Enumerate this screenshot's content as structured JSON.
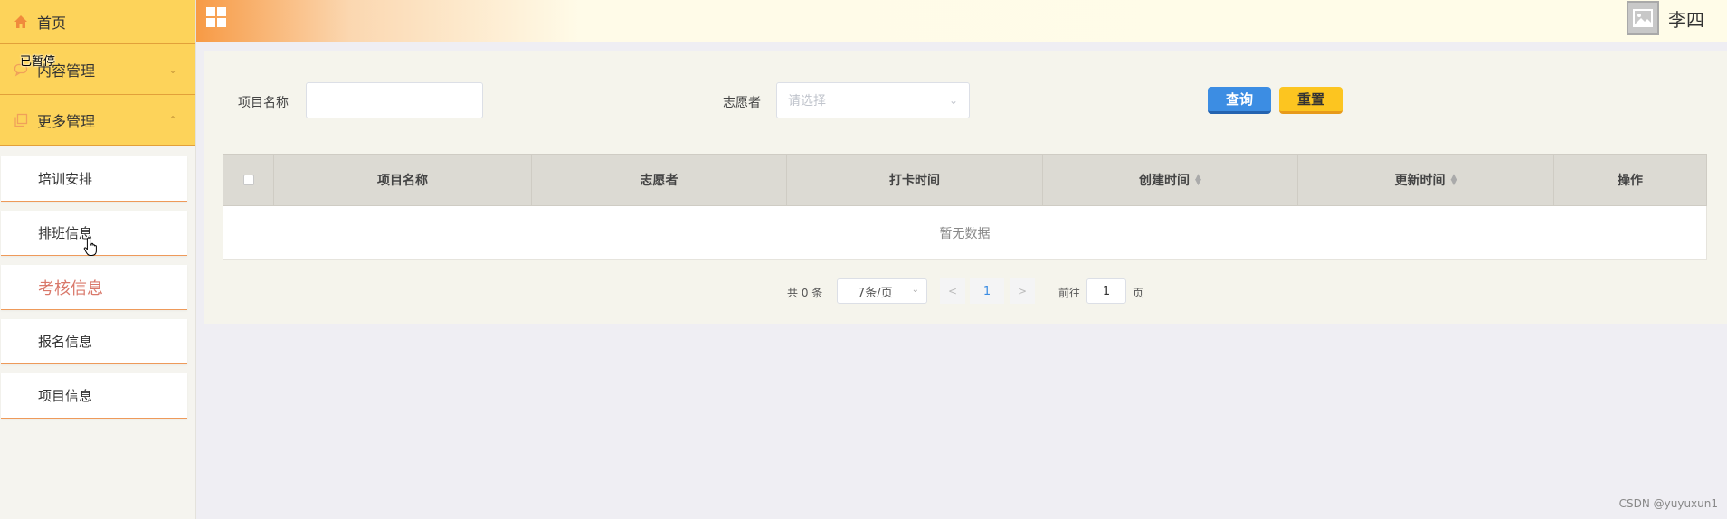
{
  "sidebar": {
    "home": {
      "label": "首页",
      "icon": "home-icon"
    },
    "content_mgmt": {
      "label": "内容管理",
      "icon": "chat-icon"
    },
    "more_mgmt": {
      "label": "更多管理",
      "icon": "copy-icon"
    },
    "overlay_label": "已暂停",
    "items": [
      {
        "label": "培训安排"
      },
      {
        "label": "排班信息"
      },
      {
        "label": "考核信息"
      },
      {
        "label": "报名信息"
      },
      {
        "label": "项目信息"
      }
    ],
    "active_index": 2
  },
  "header": {
    "username": "李四"
  },
  "search": {
    "project_name_label": "项目名称",
    "project_name_value": "",
    "volunteer_label": "志愿者",
    "volunteer_placeholder": "请选择",
    "query_label": "查询",
    "reset_label": "重置"
  },
  "table": {
    "columns": [
      "项目名称",
      "志愿者",
      "打卡时间",
      "创建时间",
      "更新时间",
      "操作"
    ],
    "empty_text": "暂无数据"
  },
  "pagination": {
    "total": "共 0 条",
    "page_size": "7条/页",
    "current_page": "1",
    "goto_label": "前往",
    "goto_value": "1",
    "page_suffix": "页"
  },
  "watermark": "CSDN @yuyuxun1",
  "colors": {
    "sidebar_active_bg": "#fdd35a",
    "accent_orange": "#ee9a5a",
    "query_blue": "#3c8de3",
    "reset_yellow": "#fcc520",
    "active_item_text": "#d9786a"
  }
}
